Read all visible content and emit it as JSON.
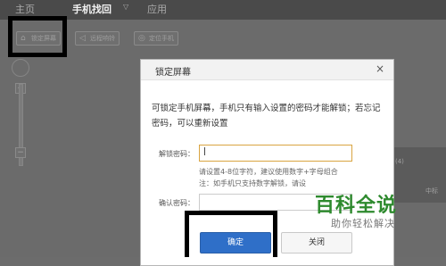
{
  "nav": {
    "items": [
      {
        "label": "主页"
      },
      {
        "label": "手机找回"
      },
      {
        "label": "应用"
      }
    ]
  },
  "toolbar": {
    "lock_label": "锁定屏幕",
    "sound_label": "远程响铃",
    "locate_label": "定位手机"
  },
  "right_panel": {
    "text_a": "(4)",
    "text_b": "中标"
  },
  "dialog": {
    "title": "锁定屏幕",
    "close_glyph": "×",
    "description": "可锁定手机屏幕，手机只有输入设置的密码才能解锁；若忘记密码，可以重新设置",
    "password_label": "解锁密码：",
    "password_value": "|",
    "hint_1": "请设置4-8位字符，建议使用数字+字母组合",
    "hint_2": "注：如手机只支持数字解锁，请设",
    "confirm_label": "确认密码：",
    "ok_label": "确定",
    "close_label": "关闭"
  },
  "watermark": {
    "logo": "百科全说",
    "sub": "助你轻松解决"
  },
  "colors": {
    "primary_button": "#2f6fc8",
    "watermark_green": "#2e8a2e",
    "highlight_box": "#000000"
  }
}
